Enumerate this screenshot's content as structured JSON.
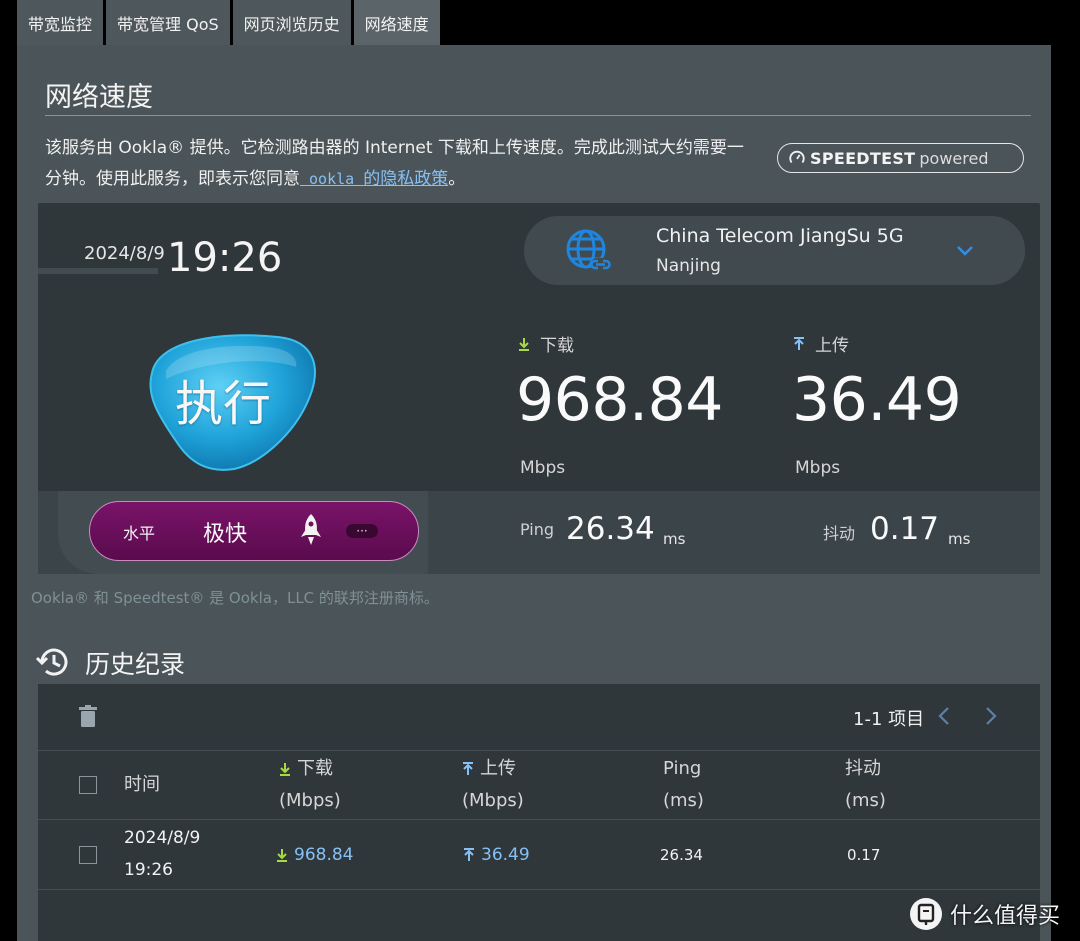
{
  "tabs": [
    {
      "label": "带宽监控"
    },
    {
      "label": "带宽管理 QoS"
    },
    {
      "label": "网页浏览历史"
    },
    {
      "label": "网络速度",
      "active": true
    }
  ],
  "page": {
    "title": "网络速度",
    "description_part1": "该服务由 Ookla® 提供。它检测路由器的 Internet 下载和上传速度。完成此测试大约需要一分钟。使用此服务，即表示您同意",
    "privacy_link_en": " ookla ",
    "privacy_link_zh": "的隐私政策",
    "description_end": "。",
    "badge_speedtest": "SPEEDTEST",
    "badge_powered": "powered"
  },
  "result": {
    "date": "2024/8/9",
    "time": "19:26",
    "server_name": "China Telecom JiangSu 5G",
    "server_city": "Nanjing",
    "go_button": "执行",
    "download_label": "下载",
    "download_value": "968.84",
    "download_unit": "Mbps",
    "upload_label": "上传",
    "upload_value": "36.49",
    "upload_unit": "Mbps",
    "level_label": "水平",
    "level_value": "极快",
    "more_label": "···",
    "ping_label": "Ping",
    "ping_value": "26.34",
    "ping_unit": "ms",
    "jitter_label": "抖动",
    "jitter_value": "0.17",
    "jitter_unit": "ms"
  },
  "trademark": "Ookla® 和 Speedtest® 是 Ookla，LLC 的联邦注册商标。",
  "history": {
    "title": "历史纪录",
    "pager": "1-1 项目",
    "columns": {
      "time": "时间",
      "download": "下载",
      "download_unit": "(Mbps)",
      "upload": "上传",
      "upload_unit": "(Mbps)",
      "ping": "Ping",
      "ping_unit": "(ms)",
      "jitter": "抖动",
      "jitter_unit": "(ms)"
    },
    "rows": [
      {
        "date": "2024/8/9",
        "time": "19:26",
        "download": "968.84",
        "upload": "36.49",
        "ping": "26.34",
        "jitter": "0.17"
      }
    ]
  },
  "watermark": {
    "text": "什么值得买"
  },
  "colors": {
    "accent": "#86c0f5",
    "download_arrow": "#a6d944",
    "upload_arrow": "#86c0f5",
    "level_pill": "#6e1160"
  },
  "icons": [
    "globe-link-icon",
    "chevron-down-icon",
    "rocket-icon",
    "history-icon",
    "trash-icon",
    "chevron-left-icon",
    "chevron-right-icon",
    "download-arrow-icon",
    "upload-arrow-icon",
    "speedtest-gauge-icon"
  ]
}
